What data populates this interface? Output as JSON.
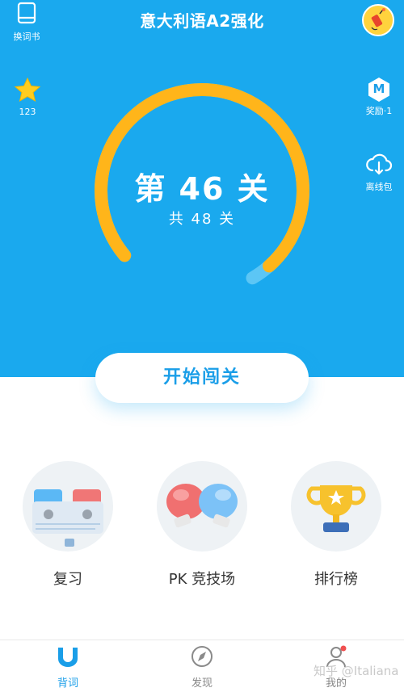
{
  "header": {
    "title": "意大利语A2强化",
    "change_book_label": "换词书",
    "stars_count": "123",
    "reward_label": "奖励·1",
    "reward_badge": "M",
    "offline_label": "离线包"
  },
  "progress": {
    "level_text": "第 46 关",
    "total_text": "共 48 关",
    "current": 46,
    "total": 48
  },
  "start_button": {
    "label": "开始闯关"
  },
  "features": [
    {
      "label": "复习"
    },
    {
      "label": "PK 竞技场"
    },
    {
      "label": "排行榜"
    }
  ],
  "tabs": [
    {
      "label": "背词",
      "active": true
    },
    {
      "label": "发现",
      "active": false
    },
    {
      "label": "我的",
      "active": false
    }
  ],
  "watermark": "知乎 @Italiana",
  "colors": {
    "primary": "#1aa9ee",
    "ring": "#ffb51a",
    "tab_active": "#1a9ee8"
  }
}
